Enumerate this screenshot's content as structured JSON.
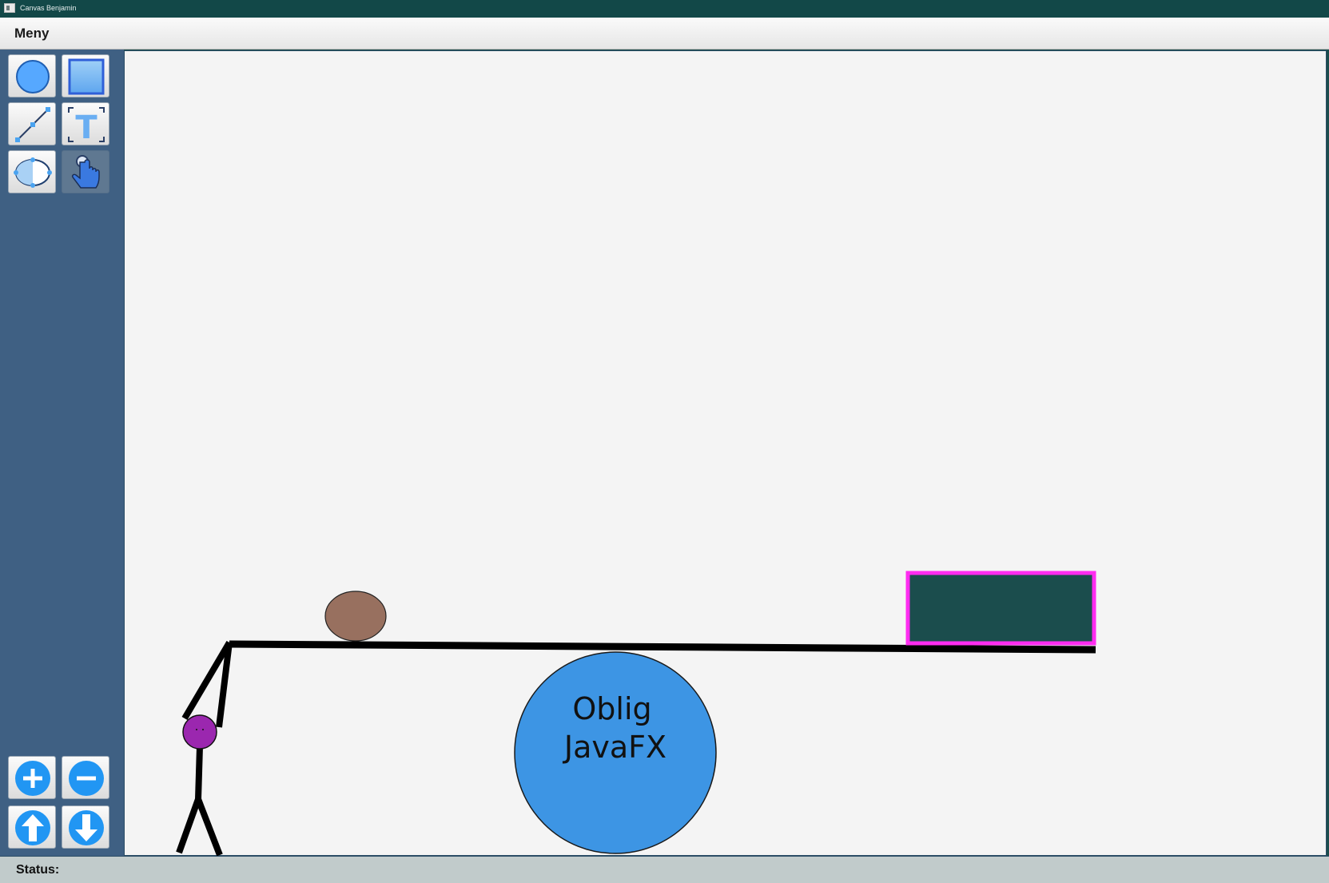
{
  "window": {
    "title": "Canvas Benjamin"
  },
  "menubar": {
    "menu_label": "Meny"
  },
  "toolbar": {
    "tools": [
      {
        "name": "circle-tool",
        "icon": "circle-icon"
      },
      {
        "name": "rectangle-tool",
        "icon": "rectangle-icon"
      },
      {
        "name": "line-tool",
        "icon": "line-icon"
      },
      {
        "name": "text-tool",
        "icon": "text-icon"
      },
      {
        "name": "ellipse-tool",
        "icon": "ellipse-icon"
      },
      {
        "name": "select-tool",
        "icon": "hand-pointer-icon",
        "active": true
      }
    ],
    "actions": [
      {
        "name": "zoom-in",
        "icon": "plus-icon"
      },
      {
        "name": "zoom-out",
        "icon": "minus-icon"
      },
      {
        "name": "bring-forward",
        "icon": "arrow-up-icon"
      },
      {
        "name": "send-backward",
        "icon": "arrow-down-icon"
      }
    ],
    "accent": "#2196f3"
  },
  "canvas": {
    "background": "#f4f4f4",
    "shapes": {
      "stick_figure": {
        "stroke": "#000000",
        "head_fill": "#9b27af"
      },
      "brown_ellipse": {
        "fill": "#98705f"
      },
      "platform_line": {
        "stroke": "#000000"
      },
      "dark_rectangle": {
        "fill": "#1b4d4d",
        "stroke": "#ff2cf0"
      },
      "blue_circle": {
        "fill": "#3d95e4",
        "stroke": "#1a1a1a",
        "text_line_1": "Oblig",
        "text_line_2": "JavaFX"
      }
    }
  },
  "statusbar": {
    "label": "Status:",
    "value": ""
  }
}
